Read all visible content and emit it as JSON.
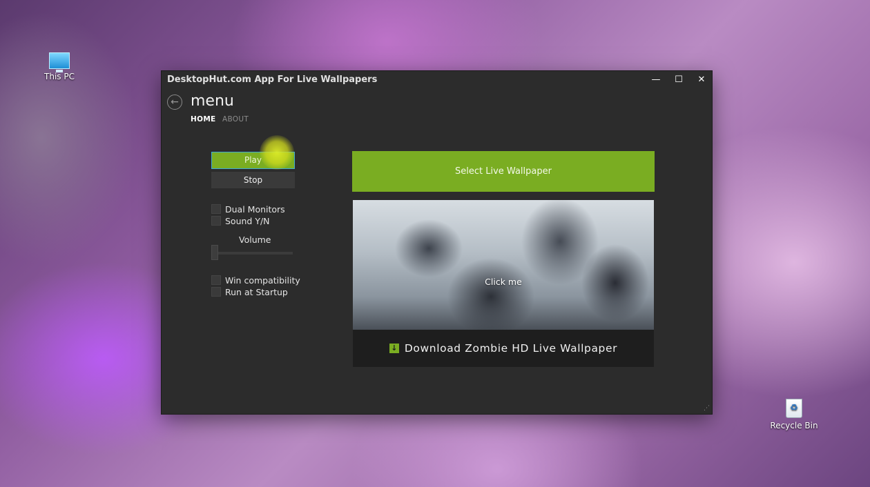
{
  "desktop": {
    "this_pc": "This PC",
    "recycle_bin": "Recycle Bin"
  },
  "window": {
    "title": "DesktopHut.com App For Live Wallpapers",
    "controls": {
      "minimize": "—",
      "maximize": "☐",
      "close": "✕"
    }
  },
  "header": {
    "back_glyph": "←",
    "menu_title": "menu",
    "nav": {
      "home": "HOME",
      "about": "ABOUT"
    }
  },
  "controls": {
    "play": "Play",
    "stop": "Stop",
    "dual_monitors": "Dual Monitors",
    "sound": "Sound Y/N",
    "volume_label": "Volume",
    "volume_level": 0,
    "win_compat": "Win compatibility",
    "run_startup": "Run at Startup"
  },
  "main": {
    "select_button": "Select Live Wallpaper",
    "preview_click": "Click me",
    "download_text": "Download Zombie HD Live Wallpaper"
  },
  "colors": {
    "accent_green": "#7aad22",
    "window_bg": "#2c2c2c",
    "focus_blue": "#3fa9d6"
  }
}
